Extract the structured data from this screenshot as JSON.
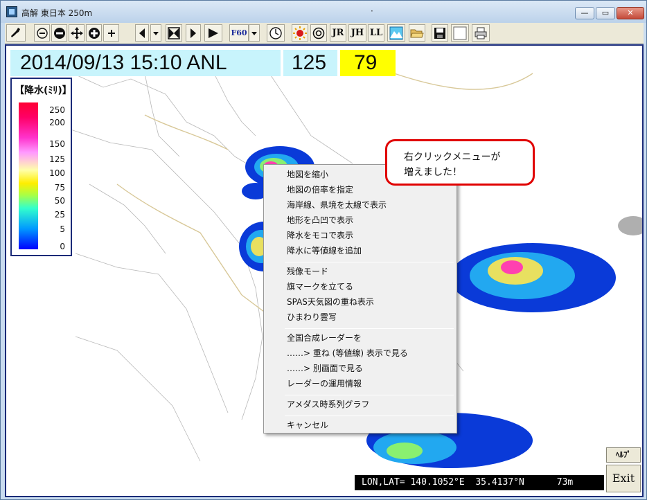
{
  "window": {
    "title": "高解 東日本 250m",
    "center_mark": "·",
    "controls": {
      "minimize": "—",
      "maximize": "▭",
      "close": "✕"
    }
  },
  "toolbar": {
    "buttons": [
      {
        "name": "japan-map-icon",
        "label": ""
      },
      {
        "name": "zoom-out-small-icon",
        "label": ""
      },
      {
        "name": "zoom-out-icon",
        "label": ""
      },
      {
        "name": "pan-icon",
        "label": ""
      },
      {
        "name": "zoom-in-icon",
        "label": ""
      },
      {
        "name": "zoom-in-small-icon",
        "label": ""
      },
      {
        "name": "step-back-icon",
        "label": ""
      },
      {
        "name": "dropdown-icon",
        "label": ""
      },
      {
        "name": "stop-icon",
        "label": ""
      },
      {
        "name": "step-forward-icon",
        "label": ""
      },
      {
        "name": "play-icon",
        "label": ""
      },
      {
        "name": "f60-button",
        "label": "F60"
      },
      {
        "name": "dropdown-icon",
        "label": ""
      },
      {
        "name": "clock-icon",
        "label": ""
      },
      {
        "name": "sun-icon",
        "label": ""
      },
      {
        "name": "target-icon",
        "label": ""
      },
      {
        "name": "jr-button",
        "label": "JR"
      },
      {
        "name": "jh-button",
        "label": "JH"
      },
      {
        "name": "ll-button",
        "label": "LL"
      },
      {
        "name": "terrain-icon",
        "label": ""
      },
      {
        "name": "folder-open-icon",
        "label": ""
      },
      {
        "name": "save-icon",
        "label": ""
      },
      {
        "name": "blank-icon",
        "label": ""
      },
      {
        "name": "printer-icon",
        "label": ""
      }
    ]
  },
  "header": {
    "datetime": "2014/09/13 15:10 ANL",
    "count_a": "125",
    "count_b": "79"
  },
  "legend": {
    "title": "【降水(ﾐﾘ)】",
    "values": [
      "250",
      "200",
      "150",
      "125",
      "100",
      "75",
      "50",
      "25",
      "5",
      "0"
    ]
  },
  "context_menu": {
    "groups": [
      [
        "地図を縮小",
        "地図の倍率を指定",
        "海岸線、県境を太線で表示",
        "地形を凸凹で表示",
        "降水をモコで表示",
        "降水に等値線を追加"
      ],
      [
        "残像モード",
        "旗マークを立てる",
        "SPAS天気図の重ね表示",
        "ひまわり雲写"
      ],
      [
        "全国合成レーダーを",
        "……> 重ね (等値線) 表示で見る",
        "……> 別画面で見る",
        "レーダーの運用情報"
      ],
      [
        "アメダス時系列グラフ"
      ],
      [
        "キャンセル"
      ]
    ]
  },
  "annotation": {
    "line1": "右クリックメニューが",
    "line2": "増えました！"
  },
  "status": {
    "text": "LON,LAT= 140.1052°E  35.4137°N      73m"
  },
  "buttons": {
    "help": "ﾍﾙﾌﾟ",
    "exit": "Exit"
  },
  "colors": {
    "header_bg": "#c8f4fc",
    "count_b_bg": "#ffff00",
    "frame": "#1a2a78",
    "annotation_border": "#e00000"
  }
}
